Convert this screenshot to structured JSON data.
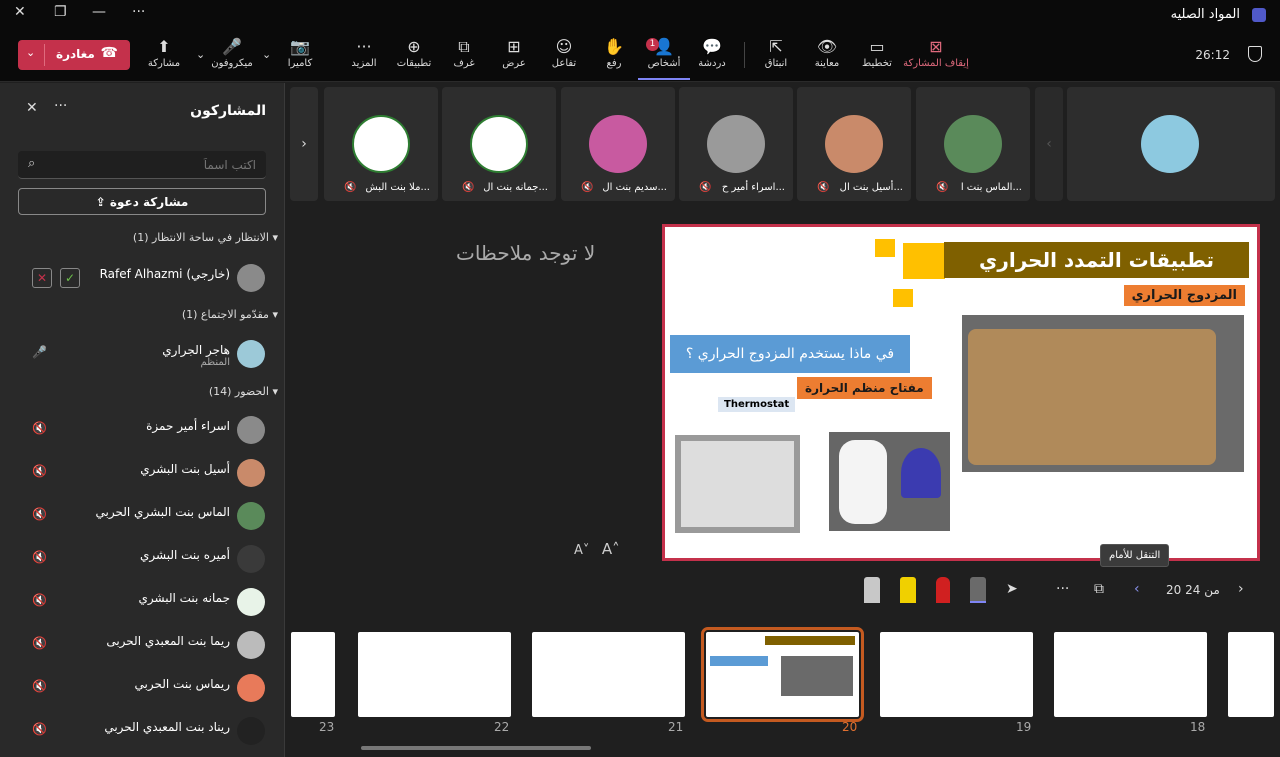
{
  "window": {
    "title": "المواد الصليه",
    "more": "···",
    "minimize": "—",
    "restore": "❐",
    "close": "✕"
  },
  "toolbar": {
    "leave": "مغادرة",
    "share": "مشاركة",
    "mic": "ميكروفون",
    "camera": "كاميرا",
    "more": "المزيد",
    "apps": "تطبيقات",
    "rooms": "غرف",
    "view": "عرض",
    "react": "تفاعل",
    "raise": "رفع",
    "people": "أشخاص",
    "people_badge": "1",
    "chat": "دردشة",
    "popout": "انبثاق",
    "preview": "معاينة",
    "layout": "تخطيط",
    "stop_share": "إيقاف المشاركة",
    "time": "26:12"
  },
  "sidebar": {
    "title": "المشاركون",
    "search_placeholder": "اكتب اسماً",
    "invite": "مشاركة دعوة",
    "lobby_header": "الانتظار في ساحة الانتظار (1)",
    "lobby_person": "Rafef Alhazmi (خارجي)",
    "presenters_header": "مقدّمو الاجتماع (1)",
    "presenter": {
      "name": "هاجر الجراري",
      "role": "المنظم"
    },
    "attendees_header": "الحضور (14)",
    "attendees": [
      "اسراء أمير حمزة",
      "أسيل بنت البشري",
      "الماس بنت البشري الحربي",
      "أميره بنت البشري",
      "جمانه بنت البشري",
      "ريما بنت المعبدي الحربى",
      "ريماس بنت الحربي",
      "ريناد بنت المعبدي الحربي"
    ]
  },
  "tiles": [
    "الماس بنت ا...",
    "أسيل بنت ال...",
    "اسراء أمير ح...",
    "سديم بنت ال...",
    "جمانه بنت ال...",
    "ملا بنت البش..."
  ],
  "notes": "لا توجد ملاحظات",
  "font_small": "A˅",
  "font_large": "A˄",
  "tooltip": "التنقل للأمام",
  "slide_counter": "20 من 24",
  "slide": {
    "title": "تطبيقات التمدد الحراري",
    "subtitle": "المزدوج الحراري",
    "question": "في ماذا يستخدم المزدوج الحراري ؟",
    "key": "مفتاح منظم الحرارة",
    "thermostat": "Thermostat"
  },
  "thumb_numbers": [
    "23",
    "22",
    "21",
    "20",
    "19",
    "18"
  ]
}
